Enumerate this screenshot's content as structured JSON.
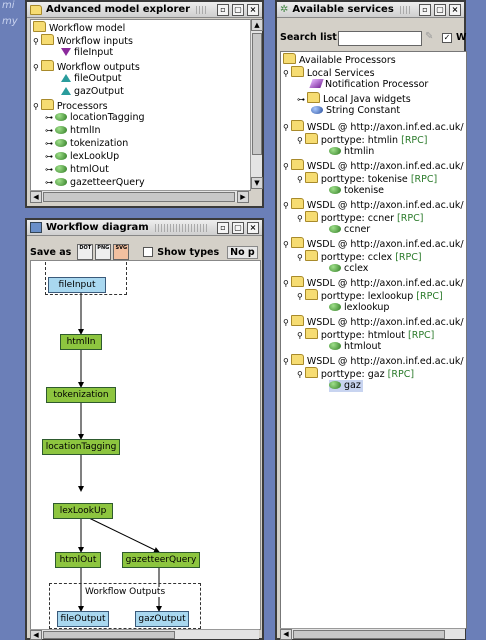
{
  "desktop": {
    "text1": "mi",
    "text2": "my"
  },
  "explorer": {
    "title": "Advanced model explorer",
    "tree": [
      {
        "label": "Workflow model",
        "icon": "folder-icon"
      },
      {
        "label": "Workflow inputs",
        "icon": "folder-icon"
      },
      {
        "label": "fileInput",
        "icon": "input-port-icon"
      },
      {
        "label": "Workflow outputs",
        "icon": "folder-icon"
      },
      {
        "label": "fileOutput",
        "icon": "output-port-icon"
      },
      {
        "label": "gazOutput",
        "icon": "output-port-icon"
      },
      {
        "label": "Processors",
        "icon": "folder-icon"
      },
      {
        "label": "locationTagging",
        "icon": "processor-icon"
      },
      {
        "label": "htmlIn",
        "icon": "processor-icon"
      },
      {
        "label": "tokenization",
        "icon": "processor-icon"
      },
      {
        "label": "lexLookUp",
        "icon": "processor-icon"
      },
      {
        "label": "htmlOut",
        "icon": "processor-icon"
      },
      {
        "label": "gazetteerQuery",
        "icon": "processor-icon"
      }
    ]
  },
  "diagram": {
    "title": "Workflow diagram",
    "save_as": "Save as",
    "formats": [
      "DOT",
      "PNG",
      "SVG"
    ],
    "show_types": "Show types",
    "cut_label": "No p",
    "nodes": {
      "fileInput": "fileInput",
      "htmlIn": "htmlIn",
      "tokenization": "tokenization",
      "locationTagging": "locationTagging",
      "lexLookUp": "lexLookUp",
      "htmlOut": "htmlOut",
      "gazetteerQuery": "gazetteerQuery",
      "outputs_label": "Workflow Outputs",
      "fileOutput": "fileOutput",
      "gazOutput": "gazOutput"
    }
  },
  "services": {
    "title": "Available services",
    "search_label": "Search list",
    "search_value": "",
    "cut_check": "W",
    "tree": [
      {
        "label": "Available Processors"
      },
      {
        "label": "Local Services"
      },
      {
        "label": "Notification Processor"
      },
      {
        "label": "Local Java widgets"
      },
      {
        "label": "String Constant"
      },
      {
        "label": "WSDL @ http://axon.inf.ed.ac.uk/"
      },
      {
        "label": "porttype: htmlin",
        "tag": "[RPC]"
      },
      {
        "label": "htmlin"
      },
      {
        "label": "WSDL @ http://axon.inf.ed.ac.uk/"
      },
      {
        "label": "porttype: tokenise",
        "tag": "[RPC]"
      },
      {
        "label": "tokenise"
      },
      {
        "label": "WSDL @ http://axon.inf.ed.ac.uk/"
      },
      {
        "label": "porttype: ccner",
        "tag": "[RPC]"
      },
      {
        "label": "ccner"
      },
      {
        "label": "WSDL @ http://axon.inf.ed.ac.uk/"
      },
      {
        "label": "porttype: cclex",
        "tag": "[RPC]"
      },
      {
        "label": "cclex"
      },
      {
        "label": "WSDL @ http://axon.inf.ed.ac.uk/"
      },
      {
        "label": "porttype: lexlookup",
        "tag": "[RPC]"
      },
      {
        "label": "lexlookup"
      },
      {
        "label": "WSDL @ http://axon.inf.ed.ac.uk/"
      },
      {
        "label": "porttype: htmlout",
        "tag": "[RPC]"
      },
      {
        "label": "htmlout"
      },
      {
        "label": "WSDL @ http://axon.inf.ed.ac.uk/"
      },
      {
        "label": "porttype: gaz",
        "tag": "[RPC]"
      },
      {
        "label": "gaz"
      }
    ]
  }
}
